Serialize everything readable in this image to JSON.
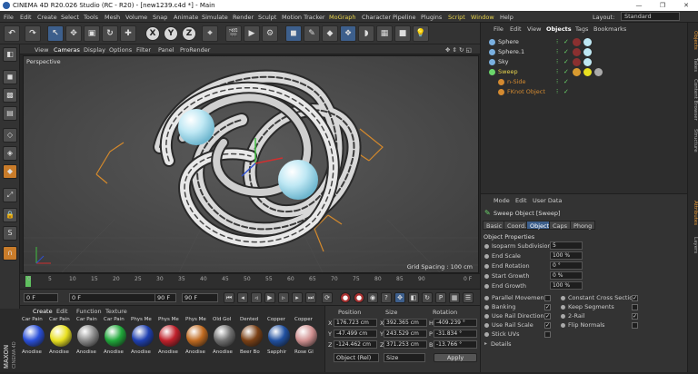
{
  "title": "CINEMA 4D R20.026 Studio (RC - R20) - [new1239.c4d *] - Main",
  "menubar": {
    "items": [
      "File",
      "Edit",
      "Create",
      "Select",
      "Tools",
      "Mesh",
      "Volume",
      "Snap",
      "Animate",
      "Simulate",
      "Render",
      "Sculpt",
      "Motion Tracker",
      "MoGraph",
      "Character",
      "Pipeline",
      "Plugins",
      "Script",
      "Window",
      "Help"
    ],
    "layout_label": "Layout:",
    "layout_value": "Standard"
  },
  "toolbar": {
    "x": "X",
    "y": "Y",
    "z": "Z"
  },
  "viewport": {
    "menu": [
      "View",
      "Cameras",
      "Display",
      "Options",
      "Filter",
      "Panel",
      "ProRender"
    ],
    "name": "Perspective",
    "grid_spacing": "Grid Spacing : 100 cm"
  },
  "timeline": {
    "ticks": [
      "0",
      "5",
      "10",
      "15",
      "20",
      "25",
      "30",
      "35",
      "40",
      "45",
      "50",
      "55",
      "60",
      "65",
      "70",
      "75",
      "80",
      "85",
      "90"
    ],
    "end_label": "0 F"
  },
  "playbar": {
    "start": "0 F",
    "current": "0 F",
    "end1": "90 F",
    "end2": "90 F"
  },
  "material_manager": {
    "menu": [
      "Create",
      "Edit",
      "Function",
      "Texture"
    ],
    "materials": [
      {
        "top": "Car Pain",
        "bottom": "Anodise",
        "color": "#2a4fd8"
      },
      {
        "top": "Car Pain",
        "bottom": "Anodise",
        "color": "#e8e020"
      },
      {
        "top": "Car Pain",
        "bottom": "Anodise",
        "color": "#8a8a8a"
      },
      {
        "top": "Car Pain",
        "bottom": "Anodise",
        "color": "#20a83a"
      },
      {
        "top": "Phys Me",
        "bottom": "Anodise",
        "color": "#1e3fb0"
      },
      {
        "top": "Phys Me",
        "bottom": "Anodise",
        "color": "#c0202a"
      },
      {
        "top": "Phys Me",
        "bottom": "Anodise",
        "color": "#c06a20"
      },
      {
        "top": "Old Gol",
        "bottom": "Anodise",
        "color": "#707070"
      },
      {
        "top": "Dented",
        "bottom": "Beer Bo",
        "color": "#7a4015"
      },
      {
        "top": "Copper",
        "bottom": "Sapphir",
        "color": "#2050a0"
      },
      {
        "top": "Copper",
        "bottom": "Rose Gl",
        "color": "#d09090"
      }
    ]
  },
  "coordinates": {
    "headers": {
      "position": "Position",
      "size": "Size",
      "rotation": "Rotation"
    },
    "rows": [
      {
        "axis": "X",
        "pos": "176.723 cm",
        "size": "392.365 cm",
        "rot_label": "H",
        "rot": "-409.239 °"
      },
      {
        "axis": "Y",
        "pos": "-47.499 cm",
        "size": "243.529 cm",
        "rot_label": "P",
        "rot": "-31.834 °"
      },
      {
        "axis": "Z",
        "pos": "-124.462 cm",
        "size": "371.253 cm",
        "rot_label": "B",
        "rot": "-13.766 °"
      }
    ],
    "mode": "Object (Rel)",
    "size_mode": "Size",
    "apply": "Apply"
  },
  "object_manager": {
    "menu": [
      "File",
      "Edit",
      "View",
      "Objects",
      "Tags",
      "Bookmarks"
    ],
    "objects": [
      {
        "name": "Sphere",
        "indent": 0,
        "color": "#7ab0e0"
      },
      {
        "name": "Sphere.1",
        "indent": 0,
        "color": "#7ab0e0"
      },
      {
        "name": "Sky",
        "indent": 0,
        "color": "#7ab0e0"
      },
      {
        "name": "Sweep",
        "indent": 0,
        "color": "#6bd66b"
      },
      {
        "name": "n-Side",
        "indent": 1,
        "color": "#d48a30"
      },
      {
        "name": "FKnot Object",
        "indent": 1,
        "color": "#d48a30"
      }
    ]
  },
  "attributes": {
    "menu": [
      "Mode",
      "Edit",
      "User Data"
    ],
    "object_title": "Sweep Object [Sweep]",
    "tabs": [
      "Basic",
      "Coord.",
      "Object",
      "Caps",
      "Phong"
    ],
    "active_tab": "Object",
    "section": "Object Properties",
    "props": [
      {
        "label": "Isoparm Subdivision",
        "value": "5"
      },
      {
        "label": "End Scale",
        "value": "100 %"
      },
      {
        "label": "End Rotation",
        "value": "0 °"
      },
      {
        "label": "Start Growth",
        "value": "0 %"
      },
      {
        "label": "End Growth",
        "value": "100 %"
      }
    ],
    "checks_left": [
      {
        "label": "Parallel Movement",
        "checked": false
      },
      {
        "label": "Banking",
        "checked": true
      },
      {
        "label": "Use Rail Direction",
        "checked": true
      },
      {
        "label": "Use Rail Scale",
        "checked": true
      },
      {
        "label": "Stick UVs",
        "checked": false
      }
    ],
    "checks_right": [
      {
        "label": "Constant Cross Section",
        "checked": true
      },
      {
        "label": "Keep Segments",
        "checked": false
      },
      {
        "label": "2-Rail",
        "checked": true
      },
      {
        "label": "Flip Normals",
        "checked": false
      }
    ],
    "details": "Details"
  },
  "right_tabs": [
    "Objects",
    "Takes",
    "Content Browser",
    "Structure",
    "Attributes",
    "Layers"
  ]
}
